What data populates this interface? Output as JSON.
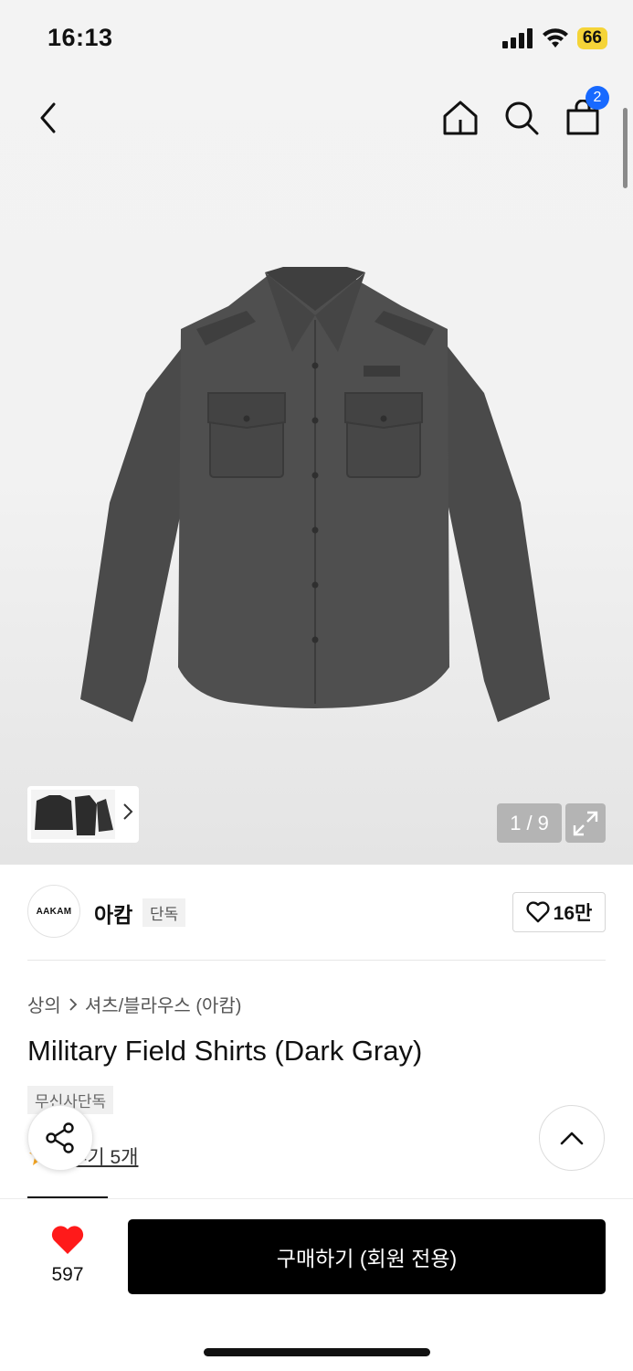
{
  "status_bar": {
    "time": "16:13",
    "battery": "66"
  },
  "nav": {
    "cart_count": "2"
  },
  "gallery": {
    "current": "1",
    "separator": "/",
    "total": "9"
  },
  "brand": {
    "logo_text": "AAKAM",
    "name": "아캄",
    "badge": "단독",
    "likes": "16만"
  },
  "breadcrumb": {
    "category": "상의",
    "subcategory": "셔츠/블라우스 (아캄)"
  },
  "product": {
    "title": "Military Field Shirts (Dark Gray)",
    "badge": "무신사단독",
    "review_link": "후기 5개"
  },
  "bottom": {
    "heart_count": "597",
    "buy_label": "구매하기 (회원 전용)"
  },
  "colors": {
    "accent_blue": "#1769ff",
    "heart_red": "#ff1a1a",
    "battery_yellow": "#f5d438",
    "shirt": "#4a4a4a"
  }
}
